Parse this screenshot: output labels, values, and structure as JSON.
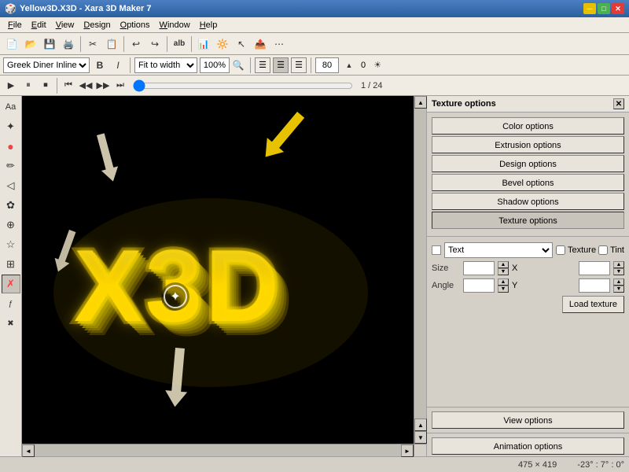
{
  "window": {
    "title": "Yellow3D.X3D - Xara 3D Maker 7",
    "icon": "3d-icon"
  },
  "titlebar": {
    "minimize": "─",
    "maximize": "□",
    "close": "✕"
  },
  "menu": {
    "items": [
      "File",
      "Edit",
      "View",
      "Design",
      "Options",
      "Window",
      "Help"
    ]
  },
  "toolbar": {
    "buttons": [
      "📄",
      "📂",
      "💾",
      "🖨️",
      "✂️",
      "📋",
      "↩️",
      "↪️",
      "alb",
      "📊",
      "🖼️",
      "📐",
      "📏"
    ]
  },
  "toolbar2": {
    "font": "Greek Diner Inline TT",
    "bold": "B",
    "italic": "I",
    "fit_to_width": "Fit to width",
    "zoom": "100%",
    "zoom_icon": "🔍",
    "align_left": "≡",
    "align_center": "≡",
    "align_right": "≡",
    "opacity": "80%",
    "opacity_label": "80",
    "arrows": "◄►"
  },
  "animbar": {
    "play": "▶",
    "pause": "⏸",
    "stop": "⏹",
    "first": "⏮",
    "prev": "◀◀",
    "next": "▶▶",
    "last": "⏭",
    "frame": "1 / 24"
  },
  "left_tools": {
    "items": [
      "Aa",
      "✎",
      "⬦",
      "◎",
      "▷",
      "✿",
      "⊕",
      "☆",
      "⧉",
      "✗"
    ]
  },
  "canvas": {
    "text": "X3D",
    "bg_color": "#000000"
  },
  "right_panel": {
    "header": "Texture options",
    "close": "✕",
    "buttons": [
      {
        "label": "Color options",
        "id": "color-options"
      },
      {
        "label": "Extrusion options",
        "id": "extrusion-options"
      },
      {
        "label": "Design options",
        "id": "design-options"
      },
      {
        "label": "Bevel options",
        "id": "bevel-options"
      },
      {
        "label": "Shadow options",
        "id": "shadow-options"
      },
      {
        "label": "Texture options",
        "id": "texture-options"
      }
    ],
    "texture_section": {
      "dropdown_value": "Text",
      "texture_label": "Texture",
      "tint_label": "Tint",
      "size_label": "Size",
      "angle_label": "Angle",
      "x_label": "X",
      "y_label": "Y",
      "load_texture": "Load texture"
    },
    "view_options": "View options",
    "animation_options": "Animation options"
  },
  "status": {
    "dimensions": "475 × 419",
    "rotation": "-23° : 7° : 0°"
  }
}
